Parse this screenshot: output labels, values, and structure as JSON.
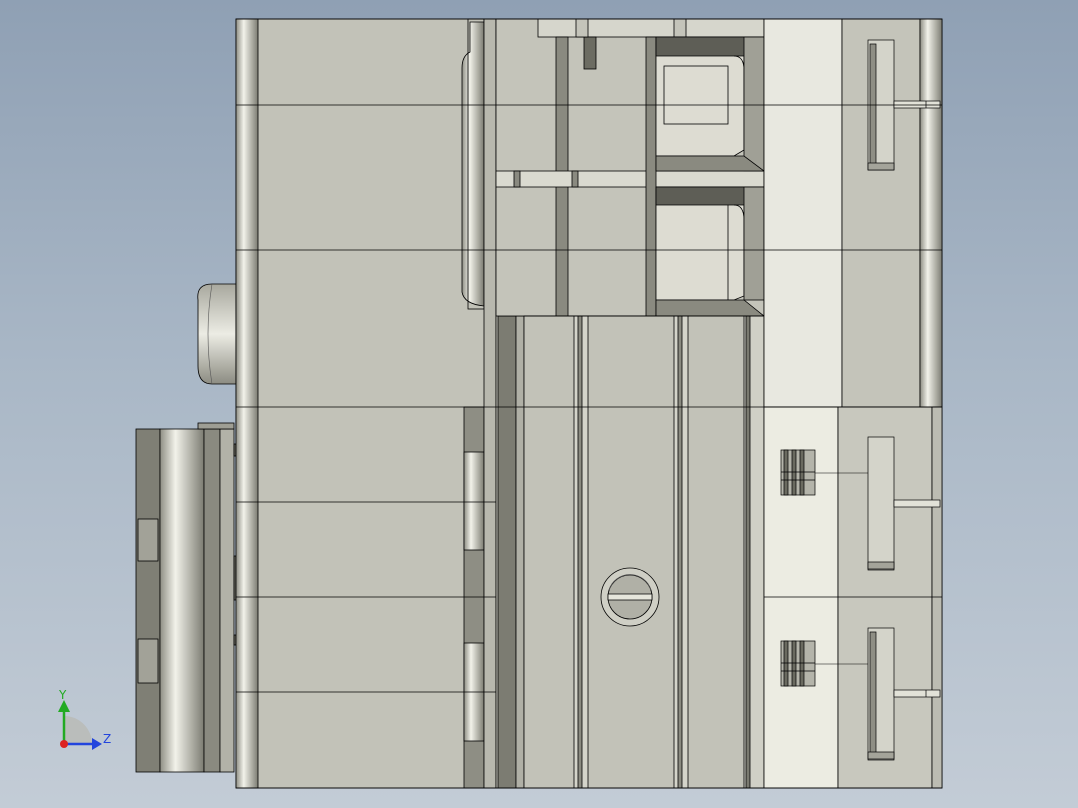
{
  "viewport": {
    "background_top": "#8fa0b4",
    "background_bottom": "#c3ccd6",
    "view": "side view"
  },
  "model": {
    "body_color": "#c0c0b6",
    "dark_color": "#7a7a70",
    "light_color": "#e6e6dc",
    "edge_color": "#000000"
  },
  "triad": {
    "y_label": "Y",
    "z_label": "Z",
    "y_color": "#22aa22",
    "z_color": "#2244dd",
    "x_color": "#dd2222"
  }
}
